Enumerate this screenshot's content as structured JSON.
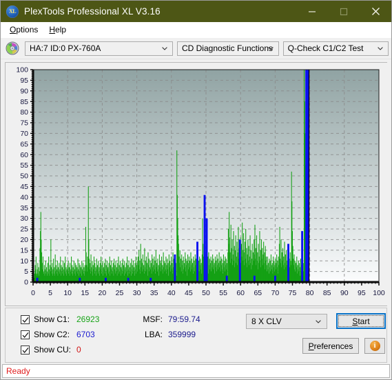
{
  "window": {
    "title": "PlexTools Professional XL V3.16",
    "icon": "xl-logo-icon",
    "controls": {
      "minimize": "minimize-icon",
      "maximize": "maximize-icon",
      "close": "close-icon"
    },
    "titlebar_color": "#4d5615"
  },
  "menubar": {
    "items": [
      {
        "label": "Options",
        "accel": "O"
      },
      {
        "label": "Help",
        "accel": "H"
      }
    ]
  },
  "toolbar": {
    "disc_icon": "cd-disc-icon",
    "drive_select": {
      "value": "HA:7 ID:0  PX-760A"
    },
    "function_select": {
      "value": "CD Diagnostic Functions"
    },
    "test_select": {
      "value": "Q-Check C1/C2 Test"
    }
  },
  "chart_data": {
    "type": "area",
    "title": "",
    "xlabel": "",
    "ylabel": "",
    "xlim": [
      0,
      100
    ],
    "ylim": [
      0,
      100
    ],
    "xticks": [
      0,
      5,
      10,
      15,
      20,
      25,
      30,
      35,
      40,
      45,
      50,
      55,
      60,
      65,
      70,
      75,
      80,
      85,
      90,
      95,
      100
    ],
    "yticks": [
      0,
      5,
      10,
      15,
      20,
      25,
      30,
      35,
      40,
      45,
      50,
      55,
      60,
      65,
      70,
      75,
      80,
      85,
      90,
      95,
      100
    ],
    "grid": true,
    "data_end_x": 79.8,
    "plot_bg_top": "#90a3a3",
    "plot_bg_bottom": "#fbfcfd",
    "gridline_color": "#8a8a8a",
    "series": [
      {
        "name": "C1",
        "color": "#14a014",
        "values": [
          3,
          5,
          2,
          4,
          8,
          6,
          12,
          4,
          3,
          6,
          9,
          4,
          7,
          3,
          5,
          16,
          24,
          33,
          20,
          14,
          9,
          6,
          12,
          5,
          4,
          8,
          3,
          6,
          10,
          4,
          7,
          3,
          5,
          9,
          4,
          12,
          6,
          3,
          8,
          5,
          20,
          7,
          4,
          9,
          3,
          6,
          11,
          4,
          7,
          3,
          13,
          5,
          8,
          4,
          6,
          10,
          3,
          7,
          5,
          9,
          4,
          6,
          12,
          3,
          8,
          5,
          7,
          4,
          10,
          6,
          3,
          9,
          5,
          12,
          4,
          7,
          3,
          6,
          8,
          5,
          10,
          4,
          7,
          3,
          9,
          5,
          6,
          12,
          4,
          8,
          3,
          7,
          5,
          10,
          4,
          6,
          9,
          3,
          8,
          5,
          7,
          4,
          11,
          6,
          3,
          9,
          5,
          8,
          4,
          7,
          3,
          10,
          6,
          5,
          9,
          4,
          7,
          3,
          8,
          5,
          26,
          14,
          8,
          5,
          12,
          7,
          45,
          20,
          11,
          6,
          9,
          4,
          13,
          7,
          5,
          10,
          3,
          8,
          6,
          12,
          4,
          9,
          5,
          7,
          3,
          11,
          6,
          8,
          4,
          10,
          5,
          7,
          3,
          9,
          6,
          12,
          4,
          8,
          5,
          10,
          3,
          7,
          6,
          9,
          4,
          11,
          5,
          8,
          3,
          10,
          6,
          7,
          4,
          9,
          5,
          12,
          3,
          8,
          6,
          10,
          4,
          7,
          5,
          9,
          3,
          11,
          6,
          8,
          4,
          10,
          5,
          7,
          3,
          9,
          6,
          12,
          4,
          8,
          5,
          10,
          3,
          7,
          6,
          9,
          4,
          11,
          5,
          8,
          3,
          10,
          6,
          7,
          4,
          9,
          5,
          12,
          3,
          8,
          6,
          10,
          4,
          7,
          5,
          9,
          3,
          11,
          6,
          8,
          4,
          10,
          5,
          7,
          3,
          9,
          6,
          12,
          4,
          8,
          5,
          10,
          12,
          8,
          15,
          6,
          10,
          4,
          18,
          7,
          11,
          5,
          9,
          13,
          6,
          8,
          4,
          16,
          7,
          10,
          5,
          12,
          6,
          9,
          3,
          14,
          8,
          11,
          5,
          7,
          10,
          6,
          9,
          4,
          13,
          7,
          11,
          5,
          8,
          12,
          6,
          10,
          4,
          15,
          7,
          9,
          5,
          11,
          6,
          8,
          3,
          13,
          7,
          10,
          5,
          9,
          12,
          6,
          8,
          4,
          14,
          7,
          10,
          5,
          9,
          6,
          12,
          4,
          8,
          11,
          6,
          9,
          3,
          13,
          7,
          10,
          5,
          8,
          12,
          6,
          9,
          4,
          14,
          7,
          11,
          5,
          8,
          10,
          6,
          9,
          3,
          62,
          41,
          30,
          22,
          18,
          12,
          9,
          15,
          7,
          11,
          5,
          13,
          8,
          10,
          4,
          12,
          6,
          9,
          7,
          14,
          5,
          11,
          8,
          10,
          3,
          13,
          6,
          9,
          12,
          7,
          10,
          5,
          14,
          8,
          11,
          6,
          9,
          4,
          12,
          7,
          10,
          5,
          13,
          8,
          11,
          6,
          9,
          3,
          14,
          7,
          10,
          5,
          12,
          8,
          11,
          6,
          9,
          4,
          13,
          30,
          18,
          12,
          8,
          15,
          6,
          11,
          9,
          13,
          5,
          10,
          7,
          12,
          4,
          14,
          8,
          11,
          6,
          9,
          12,
          5,
          10,
          7,
          13,
          6,
          11,
          8,
          9,
          4,
          12,
          7,
          10,
          5,
          13,
          8,
          11,
          6,
          9,
          14,
          7,
          10,
          5,
          12,
          8,
          11,
          6,
          9,
          4,
          13,
          7,
          10,
          5,
          12,
          8,
          11,
          6,
          9,
          3,
          14,
          25,
          18,
          33,
          21,
          14,
          9,
          27,
          16,
          11,
          20,
          8,
          13,
          24,
          10,
          17,
          7,
          15,
          22,
          9,
          12,
          19,
          8,
          14,
          26,
          11,
          16,
          6,
          13,
          21,
          9,
          18,
          12,
          28,
          15,
          10,
          23,
          8,
          14,
          19,
          11,
          25,
          9,
          16,
          7,
          13,
          20,
          10,
          17,
          8,
          12,
          22,
          9,
          15,
          6,
          11,
          18,
          8,
          14,
          10,
          20,
          13,
          27,
          11,
          16,
          8,
          22,
          10,
          14,
          6,
          18,
          9,
          12,
          24,
          10,
          15,
          7,
          20,
          11,
          16,
          8,
          13,
          19,
          9,
          14,
          6,
          17,
          10,
          12,
          8,
          5,
          12,
          6,
          9,
          4,
          11,
          7,
          10,
          5,
          13,
          8,
          6,
          9,
          4,
          12,
          7,
          10,
          5,
          8,
          11,
          6,
          9,
          13,
          7,
          10,
          4,
          12,
          8,
          18,
          26,
          11,
          9,
          20,
          7,
          14,
          10,
          16,
          8,
          12,
          6,
          19,
          9,
          13,
          7,
          15,
          10,
          8,
          12,
          6,
          17,
          9,
          11,
          7,
          14,
          10,
          8,
          52,
          38,
          24,
          17,
          11,
          8,
          13,
          6,
          10,
          5,
          9,
          7,
          12,
          4,
          8,
          6,
          10,
          5,
          9,
          3,
          7,
          11,
          5,
          8,
          4,
          10,
          6,
          9,
          5,
          100,
          85,
          70,
          55,
          40,
          28,
          18,
          12,
          8,
          5,
          3,
          2
        ]
      },
      {
        "name": "C2",
        "color": "#0b12f0",
        "spikes": [
          {
            "x": 1.2,
            "height": 2
          },
          {
            "x": 13.5,
            "height": 2
          },
          {
            "x": 21.0,
            "height": 2
          },
          {
            "x": 27.5,
            "height": 2
          },
          {
            "x": 34.0,
            "height": 2
          },
          {
            "x": 41.0,
            "height": 13
          },
          {
            "x": 47.5,
            "height": 19
          },
          {
            "x": 49.6,
            "height": 41
          },
          {
            "x": 50.2,
            "height": 30
          },
          {
            "x": 56.0,
            "height": 3
          },
          {
            "x": 59.8,
            "height": 20
          },
          {
            "x": 64.0,
            "height": 3
          },
          {
            "x": 70.0,
            "height": 3
          },
          {
            "x": 73.8,
            "height": 18
          },
          {
            "x": 77.8,
            "height": 24
          },
          {
            "x": 79.0,
            "height": 100
          },
          {
            "x": 79.4,
            "height": 100
          }
        ]
      }
    ]
  },
  "controls": {
    "show_c1": {
      "label": "Show C1:",
      "value": "26923",
      "color": "#17a317",
      "checked": true
    },
    "show_c2": {
      "label": "Show C2:",
      "value": "6703",
      "color": "#1a1acf",
      "checked": true
    },
    "show_cu": {
      "label": "Show CU:",
      "value": "0",
      "color": "#d01414",
      "checked": true
    },
    "msf": {
      "label": "MSF:",
      "value": "79:59.74"
    },
    "lba": {
      "label": "LBA:",
      "value": "359999"
    },
    "speed_select": {
      "value": "8 X CLV"
    },
    "start_button": {
      "label": "Start",
      "accel": "S"
    },
    "preferences_button": {
      "label": "Preferences",
      "accel": "P"
    },
    "info_button": {
      "icon": "info-icon",
      "glyph": "i"
    }
  },
  "statusbar": {
    "text": "Ready"
  }
}
